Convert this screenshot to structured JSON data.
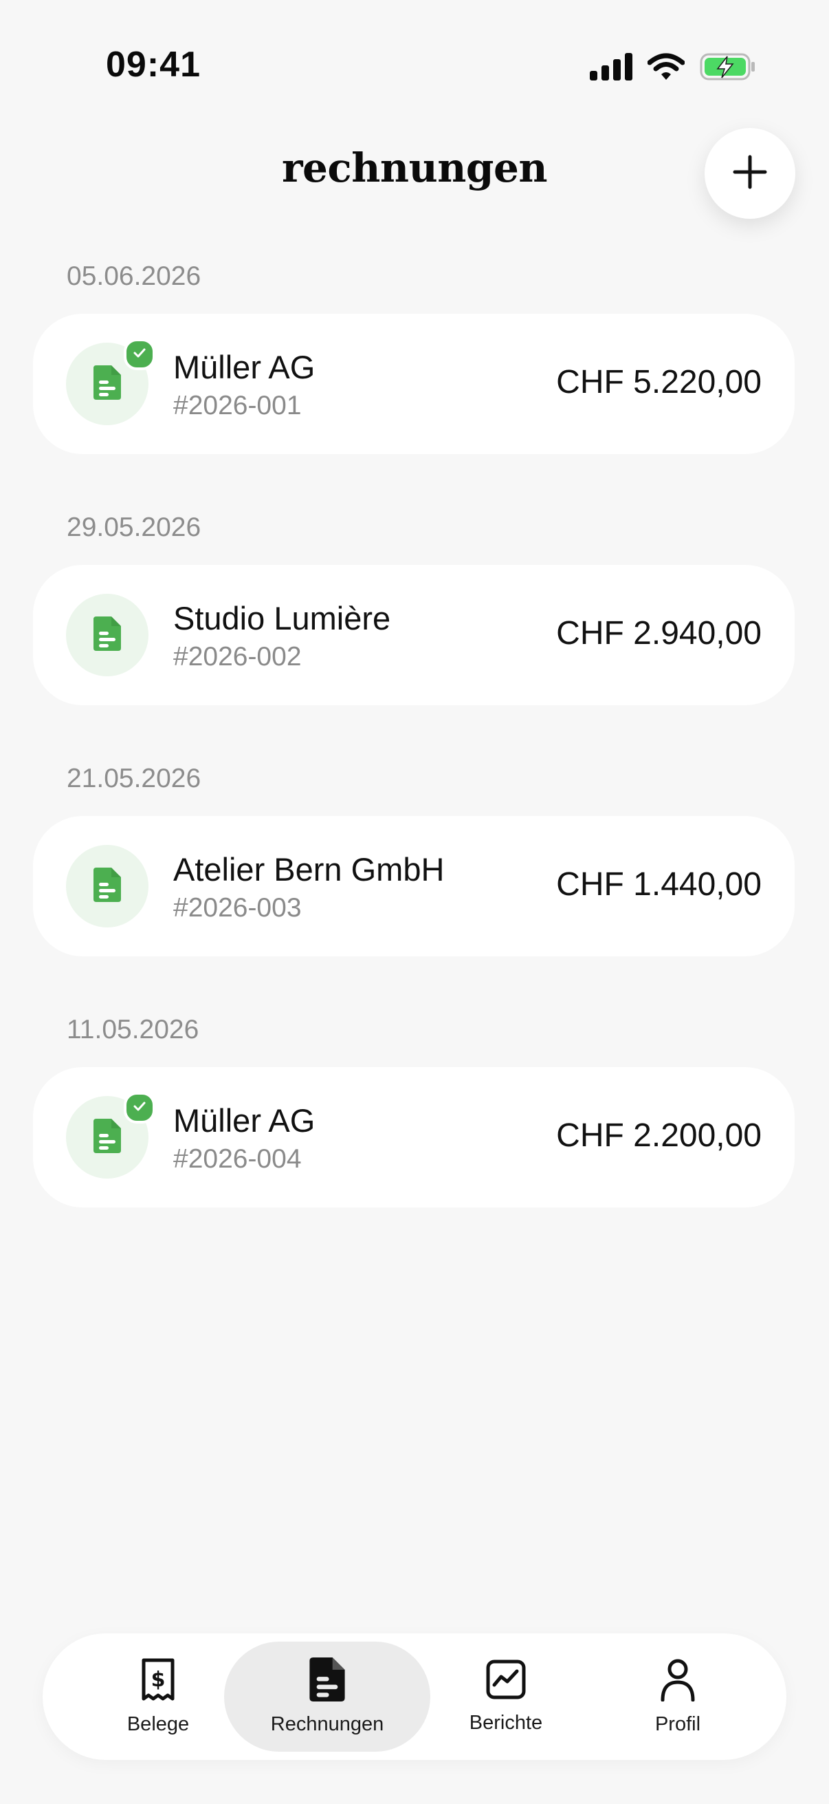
{
  "status_bar": {
    "time": "09:41",
    "icons": [
      "signal-icon",
      "wifi-icon",
      "battery-charging-icon"
    ]
  },
  "header": {
    "title": "rechnungen",
    "add_button_icon": "plus-icon"
  },
  "colors": {
    "accent_green": "#4caf50",
    "badge_bg": "#ecf6ec",
    "background": "#f7f7f7",
    "card": "#ffffff",
    "muted_text": "#8c8c8c"
  },
  "invoices": [
    {
      "date": "05.06.2026",
      "client": "Müller AG",
      "number": "#2026-001",
      "amount": "CHF 5.220,00",
      "paid": true
    },
    {
      "date": "29.05.2026",
      "client": "Studio Lumière",
      "number": "#2026-002",
      "amount": "CHF 2.940,00",
      "paid": false
    },
    {
      "date": "21.05.2026",
      "client": "Atelier Bern GmbH",
      "number": "#2026-003",
      "amount": "CHF 1.440,00",
      "paid": false
    },
    {
      "date": "11.05.2026",
      "client": "Müller AG",
      "number": "#2026-004",
      "amount": "CHF 2.200,00",
      "paid": true
    }
  ],
  "tabs": [
    {
      "label": "Belege",
      "icon": "receipt-dollar-icon",
      "active": false
    },
    {
      "label": "Rechnungen",
      "icon": "invoice-document-icon",
      "active": true
    },
    {
      "label": "Berichte",
      "icon": "chart-icon",
      "active": false
    },
    {
      "label": "Profil",
      "icon": "person-icon",
      "active": false
    }
  ]
}
